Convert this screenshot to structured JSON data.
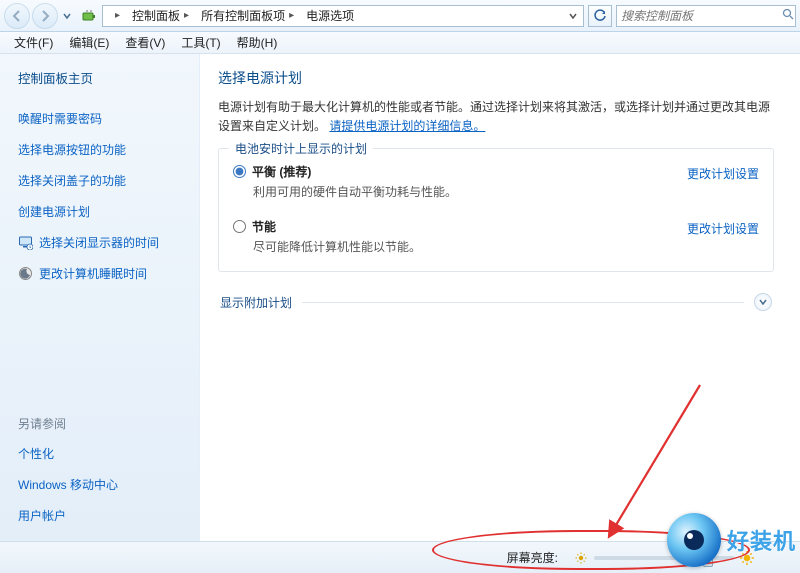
{
  "titlebar": {
    "icon_name": "power-options-icon",
    "breadcrumb": [
      "控制面板",
      "所有控制面板项",
      "电源选项"
    ],
    "search_placeholder": "搜索控制面板"
  },
  "menubar": {
    "items": [
      "文件(F)",
      "编辑(E)",
      "查看(V)",
      "工具(T)",
      "帮助(H)"
    ]
  },
  "sidebar": {
    "home": "控制面板主页",
    "links": [
      {
        "label": "唤醒时需要密码"
      },
      {
        "label": "选择电源按钮的功能"
      },
      {
        "label": "选择关闭盖子的功能"
      },
      {
        "label": "创建电源计划"
      },
      {
        "label": "选择关闭显示器的时间",
        "icon": "monitor-icon"
      },
      {
        "label": "更改计算机睡眠时间",
        "icon": "moon-icon"
      }
    ],
    "see_also_label": "另请参阅",
    "see_also": [
      "个性化",
      "Windows 移动中心",
      "用户帐户"
    ]
  },
  "main": {
    "heading": "选择电源计划",
    "description_before_link": "电源计划有助于最大化计算机的性能或者节能。通过选择计划来将其激活，或选择计划并通过更改其电源设置来自定义计划。",
    "description_link": "请提供电源计划的详细信息。",
    "group_title": "电池安时计上显示的计划",
    "plans": [
      {
        "name": "平衡 (推荐)",
        "selected": true,
        "sub": "利用可用的硬件自动平衡功耗与性能。",
        "link": "更改计划设置"
      },
      {
        "name": "节能",
        "selected": false,
        "sub": "尽可能降低计算机性能以节能。",
        "link": "更改计划设置"
      }
    ],
    "expander_label": "显示附加计划"
  },
  "bottombar": {
    "label": "屏幕亮度:",
    "slider_percent": 78
  },
  "watermark": {
    "text": "好装机"
  }
}
